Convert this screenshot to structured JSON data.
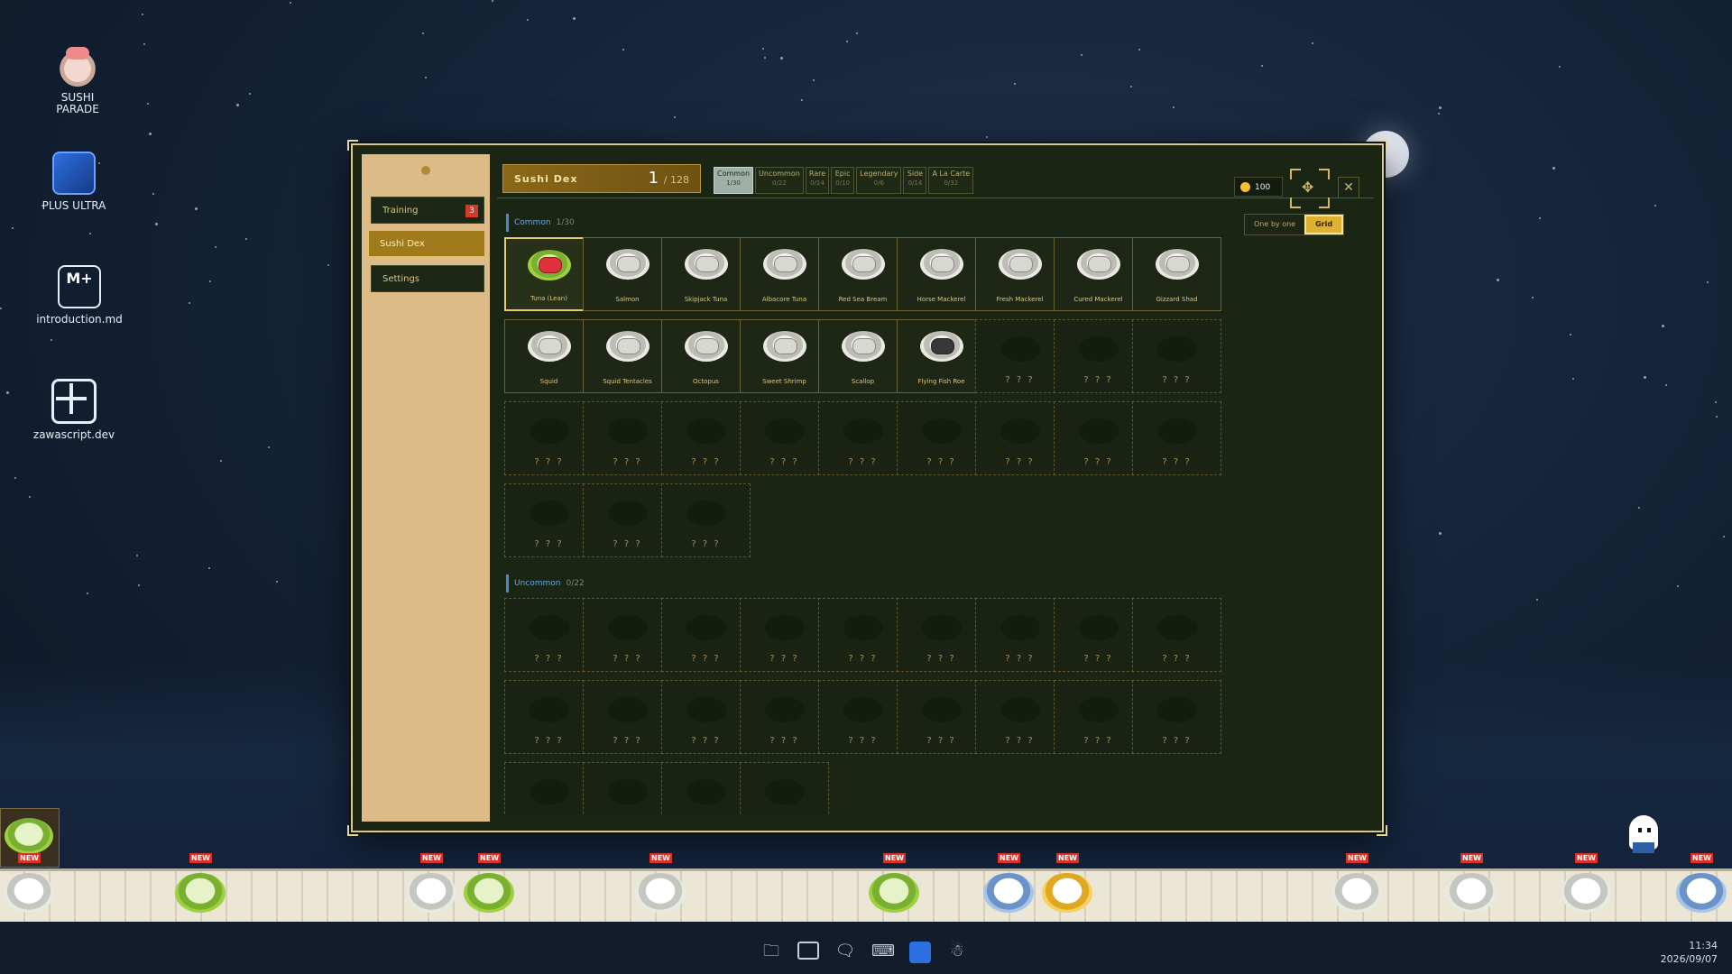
{
  "desktop": {
    "icons": [
      {
        "label_line1": "SUSHI",
        "label_line2": "PARADE",
        "icon": "sushi-parade-icon"
      },
      {
        "label_line1": "PLUS ULTRA",
        "label_line2": "",
        "icon": "plus-ultra-icon"
      },
      {
        "label_line1": "introduction.md",
        "label_line2": "",
        "icon": "markdown-file-icon"
      },
      {
        "label_line1": "zawascript.dev",
        "label_line2": "",
        "icon": "zawascript-icon"
      }
    ]
  },
  "sidebar": {
    "items": [
      {
        "label": "Training",
        "badge": "3"
      },
      {
        "label": "Sushi Dex"
      },
      {
        "label": "Settings"
      }
    ]
  },
  "header": {
    "title": "Sushi Dex",
    "count": "1",
    "total": "/ 128",
    "coins": "100",
    "close_symbol": "✕",
    "move_symbol": "✥"
  },
  "tabs": [
    {
      "label": "Common",
      "count": "1/30"
    },
    {
      "label": "Uncommon",
      "count": "0/22"
    },
    {
      "label": "Rare",
      "count": "0/14"
    },
    {
      "label": "Epic",
      "count": "0/10"
    },
    {
      "label": "Legendary",
      "count": "0/6"
    },
    {
      "label": "Side",
      "count": "0/14"
    },
    {
      "label": "A La Carte",
      "count": "0/32"
    }
  ],
  "view_toggle": {
    "one_by_one": "One by one",
    "grid": "Grid"
  },
  "sections": [
    {
      "name": "Common",
      "count": "1/30",
      "items": [
        "Tuna (Lean)",
        "Salmon",
        "Skipjack Tuna",
        "Albacore Tuna",
        "Red Sea Bream",
        "Horse Mackerel",
        "Fresh Mackerel",
        "Cured Mackerel",
        "Gizzard Shad",
        "Squid",
        "Squid Tentacles",
        "Octopus",
        "Sweet Shrimp",
        "Scallop",
        "Flying Fish Roe"
      ],
      "unknown_count": 15
    },
    {
      "name": "Uncommon",
      "count": "0/22",
      "items": [],
      "unknown_count": 22
    }
  ],
  "unknown_label": "? ? ?",
  "conveyor": {
    "new_tag": "NEW"
  },
  "clock": {
    "time": "11:34",
    "date": "2026/09/07"
  },
  "colors": {
    "accent_gold": "#e0b030",
    "panel_bg": "#1b2514",
    "sidebar_bg": "#dcbb87",
    "section_blue": "#4a88c8"
  }
}
